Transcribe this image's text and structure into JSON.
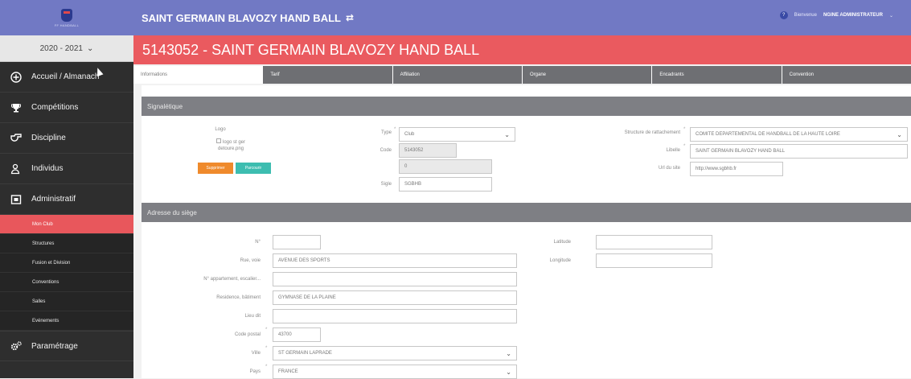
{
  "app": {
    "logo_text": "FF HANDBALL",
    "season": "2020 - 2021",
    "club_name": "SAINT GERMAIN BLAVOZY HAND BALL",
    "user_greeting": "Bienvenue",
    "user_name": "NGINE ADMINISTRATEUR",
    "user_badge": "?"
  },
  "page_title": "5143052 - SAINT GERMAIN BLAVOZY HAND BALL",
  "sidebar": {
    "items": [
      {
        "label": "Accueil / Almanach",
        "icon": "plus-circle-icon"
      },
      {
        "label": "Compétitions",
        "icon": "trophy-icon"
      },
      {
        "label": "Discipline",
        "icon": "whistle-icon"
      },
      {
        "label": "Individus",
        "icon": "users-icon"
      },
      {
        "label": "Administratif",
        "icon": "building-icon"
      }
    ],
    "sub_items": [
      "Mon Club",
      "Structures",
      "Fusion et Division",
      "Conventions",
      "Salles",
      "Evénements"
    ],
    "settings": {
      "label": "Paramétrage",
      "icon": "gears-icon"
    }
  },
  "tabs": [
    "Informations",
    "Tarif",
    "Affiliation",
    "Organe",
    "Encadrants",
    "Convention"
  ],
  "signaletique": {
    "header": "Signalétique",
    "logo_label": "Logo",
    "logo_alt": "logo st ger detoure.png",
    "delete_button": "Supprimer",
    "browse_button": "Parcourir",
    "type_label": "Type",
    "type_value": "Club",
    "code_label": "Code",
    "code_value": "5143052",
    "code2_value": "0",
    "sigle_label": "Sigle",
    "sigle_value": "SGBHB",
    "structure_label": "Structure de rattachement",
    "structure_value": "COMITE DEPARTEMENTAL DE HANDBALL DE LA HAUTE LOIRE",
    "libelle_label": "Libelle",
    "libelle_value": "SAINT GERMAIN BLAVOZY HAND BALL",
    "url_label": "Url du site",
    "url_value": "http://www.sgbhb.fr"
  },
  "adresse": {
    "header": "Adresse du siège",
    "num_label": "N°",
    "num_value": "",
    "rue_label": "Rue, voie",
    "rue_value": "AVENUE DES SPORTS",
    "appt_label": "N° appartement, escalier...",
    "appt_value": "",
    "residence_label": "Residence, bâtiment",
    "residence_value": "GYMNASE DE LA PLAINE",
    "lieu_label": "Lieu dit",
    "lieu_value": "",
    "cp_label": "Code postal",
    "cp_value": "43700",
    "ville_label": "Ville",
    "ville_value": "ST GERMAIN LAPRADE",
    "pays_label": "Pays",
    "pays_value": "FRANCE",
    "latitude_label": "Latitude",
    "latitude_value": "",
    "longitude_label": "Longitude",
    "longitude_value": ""
  },
  "colors": {
    "brand_blue": "#7179c4",
    "accent_red": "#ea5a5f",
    "btn_orange": "#ef8a2c",
    "btn_teal": "#3dbdb0"
  }
}
